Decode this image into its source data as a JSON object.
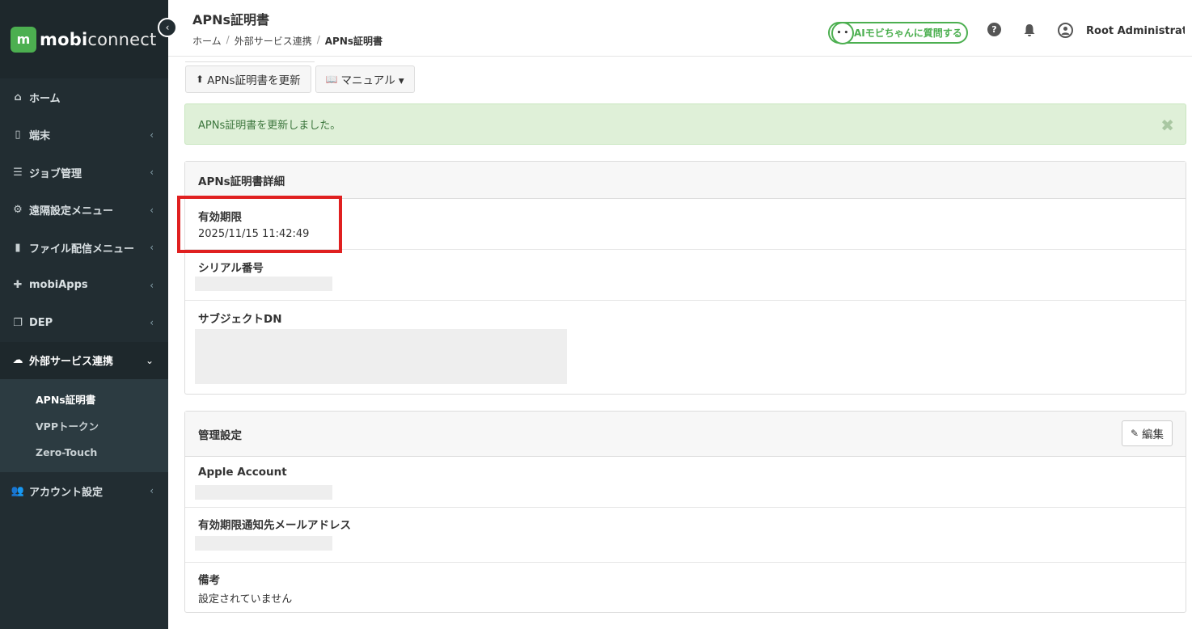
{
  "brand": {
    "logo_letter": "m",
    "name_bold": "mobi",
    "name_rest": "connect"
  },
  "sidebar": {
    "items": [
      {
        "label": "ホーム",
        "icon": "home-icon",
        "glyph": "⌂",
        "chevron": ""
      },
      {
        "label": "端末",
        "icon": "device-icon",
        "glyph": "▯",
        "chevron": "‹"
      },
      {
        "label": "ジョブ管理",
        "icon": "server-icon",
        "glyph": "☰",
        "chevron": "‹"
      },
      {
        "label": "遠隔設定メニュー",
        "icon": "cogs-icon",
        "glyph": "⚙",
        "chevron": "‹"
      },
      {
        "label": "ファイル配信メニュー",
        "icon": "file-icon",
        "glyph": "▮",
        "chevron": "‹"
      },
      {
        "label": "mobiApps",
        "icon": "puzzle-icon",
        "glyph": "✚",
        "chevron": "‹"
      },
      {
        "label": "DEP",
        "icon": "copy-icon",
        "glyph": "❐",
        "chevron": "‹"
      },
      {
        "label": "外部サービス連携",
        "icon": "cloud-icon",
        "glyph": "☁",
        "chevron": "⌄"
      }
    ],
    "subitems": [
      "APNs証明書",
      "VPPトークン",
      "Zero-Touch"
    ],
    "account": {
      "label": "アカウント設定",
      "icon": "users-icon",
      "glyph": "👥",
      "chevron": "‹"
    }
  },
  "header": {
    "title": "APNs証明書",
    "breadcrumb": [
      "ホーム",
      "外部サービス連携",
      "APNs証明書"
    ],
    "ai_button": "AIモビちゃんに質問する",
    "user_name": "Root Administrat..."
  },
  "toolbar": {
    "update_label": "APNs証明書を更新",
    "manual_label": "マニュアル ▾"
  },
  "alert": {
    "message": "APNs証明書を更新しました。"
  },
  "details_panel": {
    "title": "APNs証明書詳細",
    "expiry_label": "有効期限",
    "expiry_value": "2025/11/15 11:42:49",
    "serial_label": "シリアル番号",
    "subject_label": "サブジェクトDN"
  },
  "settings_panel": {
    "title": "管理設定",
    "edit_label": "編集",
    "apple_account_label": "Apple Account",
    "notify_label": "有効期限通知先メールアドレス",
    "notes_label": "備考",
    "notes_value": "設定されていません"
  },
  "colors": {
    "sidebar": "#222d32",
    "brand_green": "#4caf50",
    "alert_bg": "#dff0d8",
    "highlight": "#e02020"
  }
}
